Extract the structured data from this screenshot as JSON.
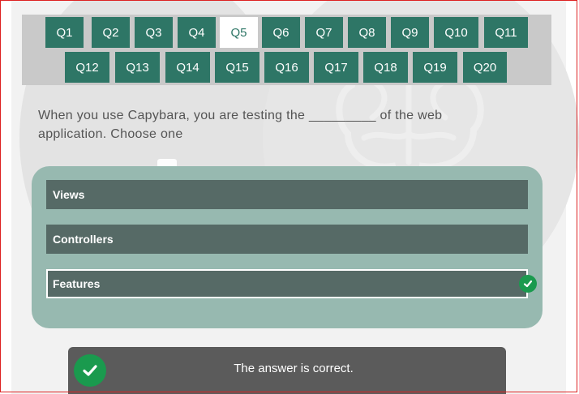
{
  "questions": [
    "Q1",
    "Q2",
    "Q3",
    "Q4",
    "Q5",
    "Q6",
    "Q7",
    "Q8",
    "Q9",
    "Q10",
    "Q11",
    "Q12",
    "Q13",
    "Q14",
    "Q15",
    "Q16",
    "Q17",
    "Q18",
    "Q19",
    "Q20"
  ],
  "active_question": "Q5",
  "question_text": "When you use Capybara, you are testing the _________ of the web application. Choose one",
  "options": [
    "Views",
    "Controllers",
    "Features"
  ],
  "selected_option": "Features",
  "feedback": "The answer is correct.",
  "colors": {
    "accent": "#2e7666",
    "option_bg": "#566a66",
    "answers_bg": "#97b9b0",
    "correct": "#1a9a4e"
  }
}
